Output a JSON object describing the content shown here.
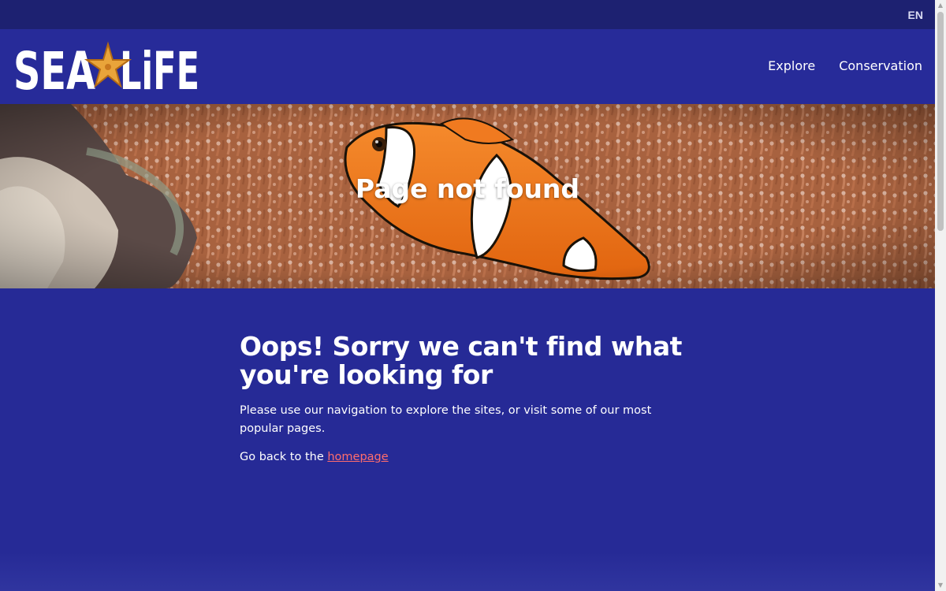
{
  "topbar": {
    "language": "EN"
  },
  "header": {
    "logo_text": "SEA LIFE",
    "nav": [
      {
        "label": "Explore"
      },
      {
        "label": "Conservation"
      }
    ]
  },
  "hero": {
    "title": "Page not found"
  },
  "content": {
    "heading": "Oops! Sorry we can't find what you're looking for",
    "body": "Please use our navigation to explore the sites, or visit some of our most popular pages.",
    "back_prefix": "Go back to the ",
    "back_link": "homepage"
  },
  "colors": {
    "topbar": "#1d2171",
    "header": "#272b99",
    "content_bg": "#262a96",
    "link": "#ff6d6d"
  },
  "icons": {
    "logo_star": "starfish-icon",
    "scroll_up": "triangle-up-icon",
    "scroll_down": "triangle-down-icon"
  }
}
